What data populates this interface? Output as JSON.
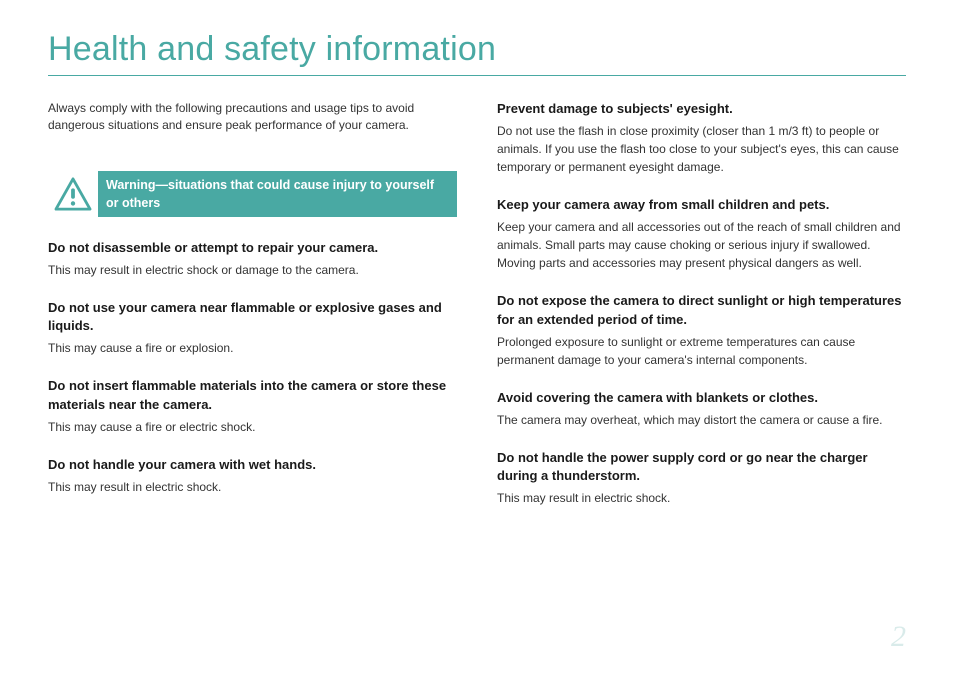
{
  "title": "Health and safety information",
  "intro": "Always comply with the following precautions and usage tips to avoid dangerous situations and ensure peak performance of your camera.",
  "warning_label": "Warning—situations that could cause injury to yourself or others",
  "left_items": [
    {
      "h": "Do not disassemble or attempt to repair your camera.",
      "b": "This may result in electric shock or damage to the camera."
    },
    {
      "h": "Do not use your camera near flammable or explosive gases and liquids.",
      "b": "This may cause a fire or explosion."
    },
    {
      "h": "Do not insert flammable materials into the camera or store these materials near the camera.",
      "b": "This may cause a fire or electric shock."
    },
    {
      "h": "Do not handle your camera with wet hands.",
      "b": "This may result in electric shock."
    }
  ],
  "right_items": [
    {
      "h": "Prevent damage to subjects' eyesight.",
      "b": "Do not use the flash in close proximity (closer than 1 m/3 ft) to people or animals. If you use the flash too close to your subject's eyes, this can cause temporary or permanent eyesight damage."
    },
    {
      "h": "Keep your camera away from small children and pets.",
      "b": "Keep your camera and all accessories out of the reach of small children and animals. Small parts may cause choking or serious injury if swallowed. Moving parts and accessories may present physical dangers as well."
    },
    {
      "h": "Do not expose the camera to direct sunlight or high temperatures for an extended period of time.",
      "b": "Prolonged exposure to sunlight or extreme temperatures can cause permanent damage to your camera's internal components."
    },
    {
      "h": "Avoid covering the camera with blankets or clothes.",
      "b": "The camera may overheat, which may distort the camera or cause a fire."
    },
    {
      "h": "Do not handle the power supply cord or go near the charger during a thunderstorm.",
      "b": "This may result in electric shock."
    }
  ],
  "page_number": "2"
}
